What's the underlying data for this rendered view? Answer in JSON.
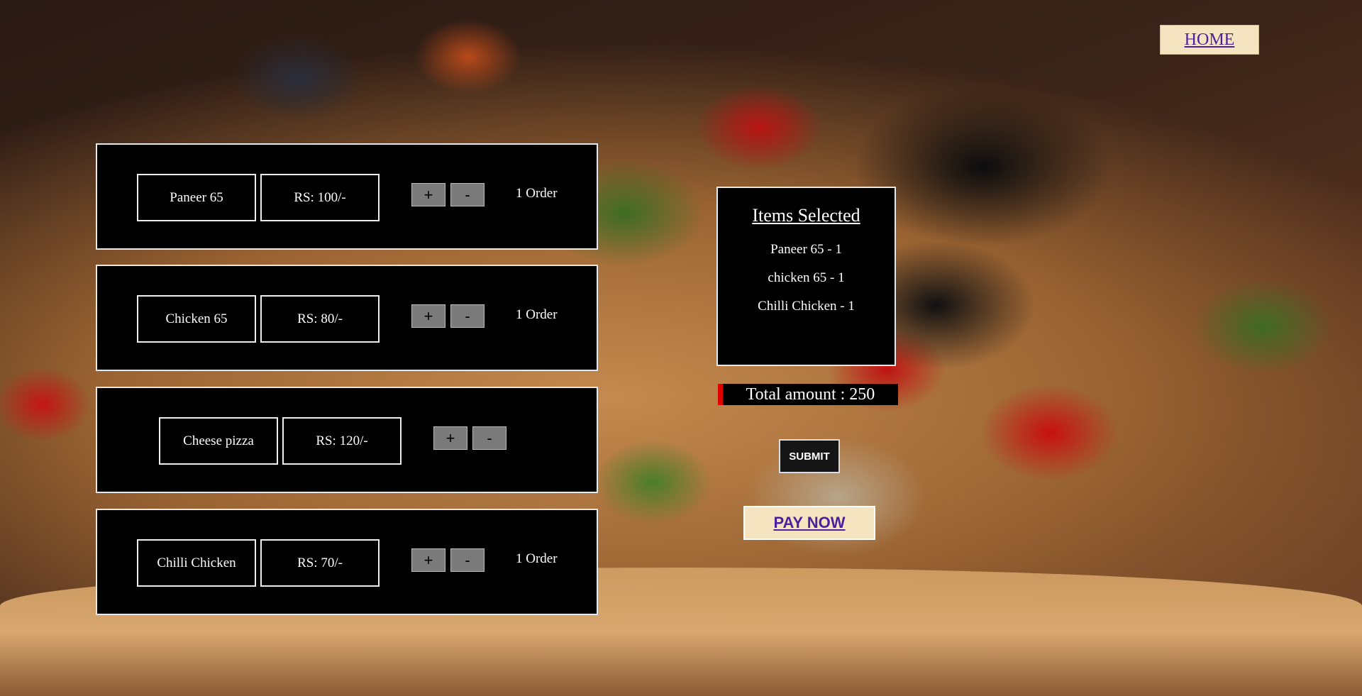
{
  "nav": {
    "home_label": "HOME"
  },
  "menu": [
    {
      "name": "Paneer 65",
      "price": "RS: 100/-",
      "plus": "+",
      "minus": "-",
      "order": "1 Order"
    },
    {
      "name": "Chicken 65",
      "price": "RS: 80/-",
      "plus": "+",
      "minus": "-",
      "order": "1 Order"
    },
    {
      "name": "Cheese pizza",
      "price": "RS: 120/-",
      "plus": "+",
      "minus": "-",
      "order": ""
    },
    {
      "name": "Chilli Chicken",
      "price": "RS: 70/-",
      "plus": "+",
      "minus": "-",
      "order": "1 Order"
    }
  ],
  "summary": {
    "title": "Items Selected",
    "items": [
      "Paneer 65 - 1",
      "chicken 65 - 1",
      "Chilli Chicken - 1"
    ]
  },
  "total_label": "Total amount : 250",
  "submit_label": "SUBMIT",
  "pay_label": "PAY NOW",
  "colors": {
    "accent_red": "#e00000",
    "button_cream": "#f5e4c0",
    "link_purple": "#4b1fa0"
  }
}
